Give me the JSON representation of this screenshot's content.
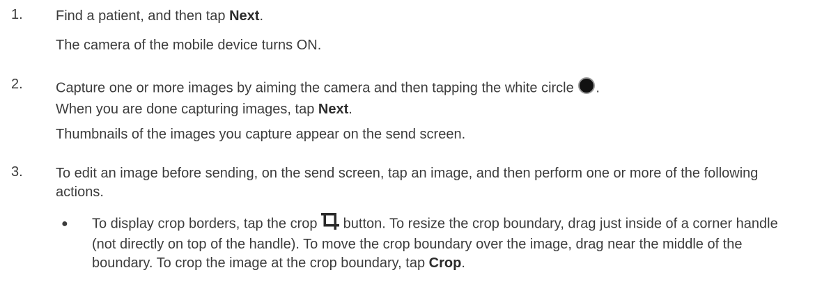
{
  "steps": [
    {
      "number": "1.",
      "main_prefix": "Find a patient, and then tap ",
      "main_bold": "Next",
      "main_suffix": ".",
      "result": "The camera of the mobile device turns ON."
    },
    {
      "number": "2.",
      "main_prefix": "Capture one or more images by aiming the camera and then tapping the white circle",
      "main_icon": "record-circle-icon",
      "main_after_icon": ".",
      "main_line2_prefix": "When you are done capturing images, tap ",
      "main_bold": "Next",
      "main_suffix": ".",
      "result": "Thumbnails of the images you capture appear on the send screen."
    },
    {
      "number": "3.",
      "main": "To edit an image before sending, on the send screen, tap an image, and then perform one or more of the following actions.",
      "bullets": [
        {
          "symbol": "●",
          "prefix": "To display crop borders, tap the crop",
          "icon": "crop-icon",
          "middle": "button. To resize the crop boundary, drag just inside of a corner handle (not directly on top of the handle). To move the crop boundary over the image, drag near the middle of the boundary. To crop the image at the crop boundary, tap ",
          "bold": "Crop",
          "suffix": "."
        }
      ]
    }
  ]
}
